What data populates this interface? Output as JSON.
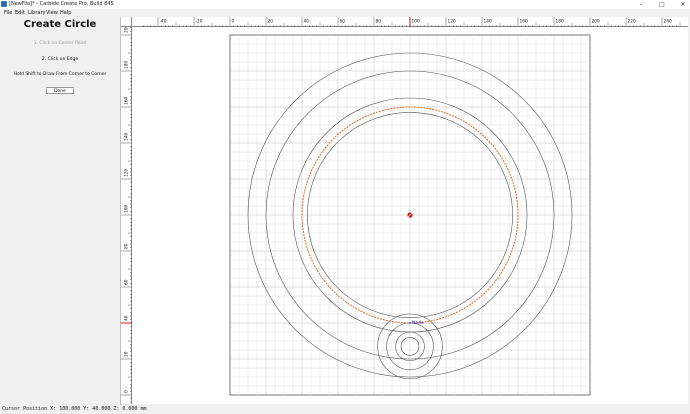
{
  "window": {
    "title": "[NewFile]* - Carbide Create Pro, Build 845",
    "minimize": "–",
    "maximize": "□",
    "close": "✕"
  },
  "menu": [
    {
      "label": "File"
    },
    {
      "label": "Edit"
    },
    {
      "label": "Library"
    },
    {
      "label": "View"
    },
    {
      "label": "Help"
    }
  ],
  "panel": {
    "title": "Create Circle",
    "step1": "1. Click on Center Point",
    "step2": "2. Click on Edge",
    "hint": "Hold Shift to Draw From Corner to Corner",
    "done_label": "Done"
  },
  "ruler": {
    "x_ticks": [
      -40,
      -20,
      0,
      20,
      40,
      60,
      80,
      100,
      120,
      140,
      160,
      180,
      200,
      220,
      240
    ],
    "y_ticks": [
      0,
      20,
      40,
      60,
      80,
      100,
      120,
      140,
      160,
      180,
      200
    ],
    "cursor_x": 100,
    "cursor_y": 40
  },
  "workspace": {
    "x_min": 0,
    "x_max": 200,
    "y_min": 0,
    "y_max": 200,
    "grid_step": 5
  },
  "circles": [
    {
      "cx": 100,
      "cy": 100,
      "r": 90,
      "color": "#555555"
    },
    {
      "cx": 100,
      "cy": 100,
      "r": 80,
      "color": "#555555"
    },
    {
      "cx": 100,
      "cy": 100,
      "r": 65,
      "color": "#555555"
    },
    {
      "cx": 100,
      "cy": 100,
      "r": 60,
      "color": "#e07020",
      "dashed": true
    },
    {
      "cx": 100,
      "cy": 100,
      "r": 57,
      "color": "#555555"
    },
    {
      "cx": 100,
      "cy": 27,
      "r": 18,
      "color": "#555555"
    },
    {
      "cx": 100,
      "cy": 27,
      "r": 13,
      "color": "#555555"
    },
    {
      "cx": 100,
      "cy": 27,
      "r": 8,
      "color": "#555555"
    },
    {
      "cx": 100,
      "cy": 27,
      "r": 5,
      "color": "#555555"
    }
  ],
  "center_marker": {
    "x": 100,
    "y": 100
  },
  "node_label": "Node",
  "node_point": {
    "x": 100,
    "y": 40
  },
  "colors": {
    "accent": "#e07020",
    "cursor": "#d01010",
    "node": "#1a2bd0"
  },
  "status": {
    "text": "Cursor Position X: 100.000 Y: 40.000 Z: 0.000 mm"
  }
}
